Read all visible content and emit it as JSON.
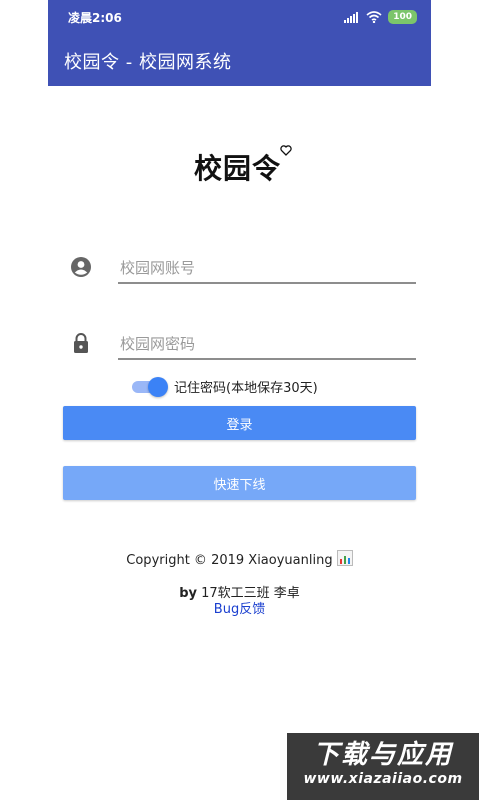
{
  "status_bar": {
    "time": "凌晨2:06",
    "battery": "100"
  },
  "app_bar": {
    "title": "校园令 - 校园网系统"
  },
  "logo": {
    "text": "校园令"
  },
  "form": {
    "username_placeholder": "校园网账号",
    "username_value": "",
    "password_placeholder": "校园网密码",
    "password_value": "",
    "remember_label": "记住密码(本地保存30天)",
    "remember_checked": true
  },
  "buttons": {
    "login_label": "登录",
    "offline_label": "快速下线"
  },
  "footer": {
    "copyright": "Copyright © 2019 Xiaoyuanling",
    "author_prefix": "by",
    "author_rest": " 17软工三班 李卓",
    "bug_link": "Bug反馈"
  },
  "watermark": {
    "title": "下载与应用",
    "url": "www.xiazaiiao.com"
  },
  "colors": {
    "app_bar": "#3f51b5",
    "login_button": "#4a8af4",
    "offline_button": "#76a8f8",
    "switch_accent": "#3b82f6",
    "link": "#1a3fcf"
  },
  "icons": [
    "signal-icon",
    "wifi-icon",
    "account-circle-icon",
    "lock-icon",
    "heart-icon",
    "chart-badge-icon"
  ]
}
